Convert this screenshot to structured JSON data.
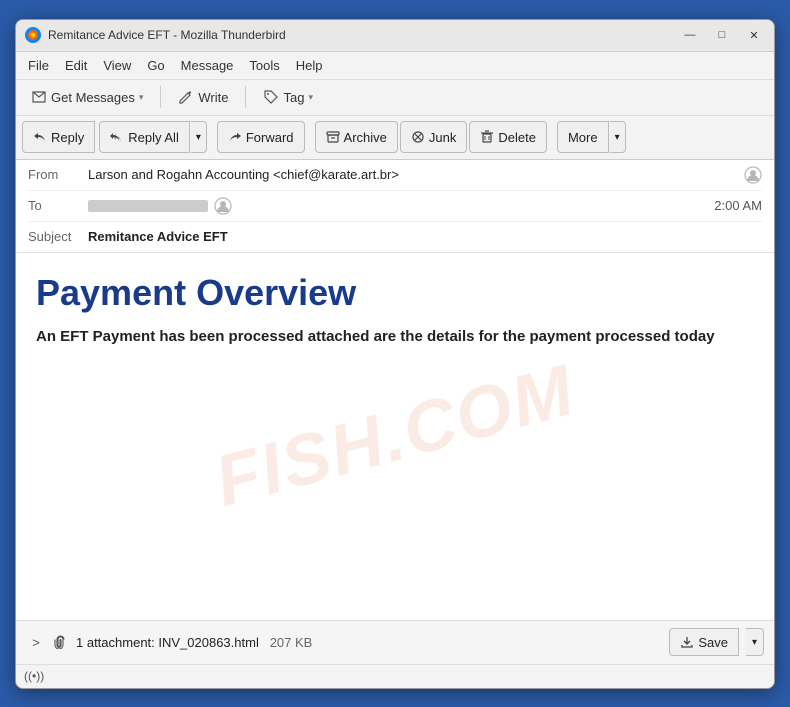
{
  "window": {
    "title": "Remitance Advice EFT - Mozilla Thunderbird"
  },
  "titlebar": {
    "controls": {
      "minimize": "—",
      "maximize": "□",
      "close": "✕"
    }
  },
  "menubar": {
    "items": [
      "File",
      "Edit",
      "View",
      "Go",
      "Message",
      "Tools",
      "Help"
    ]
  },
  "toolbar": {
    "get_messages": "Get Messages",
    "write": "Write",
    "tag": "Tag"
  },
  "actionbar": {
    "reply": "Reply",
    "reply_all": "Reply All",
    "forward": "Forward",
    "archive": "Archive",
    "junk": "Junk",
    "delete": "Delete",
    "more": "More"
  },
  "email": {
    "from_label": "From",
    "from_value": "Larson and Rogahn Accounting <chief@karate.art.br>",
    "to_label": "To",
    "time": "2:00 AM",
    "subject_label": "Subject",
    "subject_value": "Remitance Advice EFT",
    "heading": "Payment Overview",
    "body": "An EFT Payment has been processed attached are the details for the payment processed today"
  },
  "attachment": {
    "toggle": ">",
    "count_label": "1 attachment: INV_020863.html",
    "size": "207 KB",
    "save_btn": "Save"
  },
  "statusbar": {
    "icon": "((•))",
    "text": ""
  },
  "watermark": "FISH.COM"
}
